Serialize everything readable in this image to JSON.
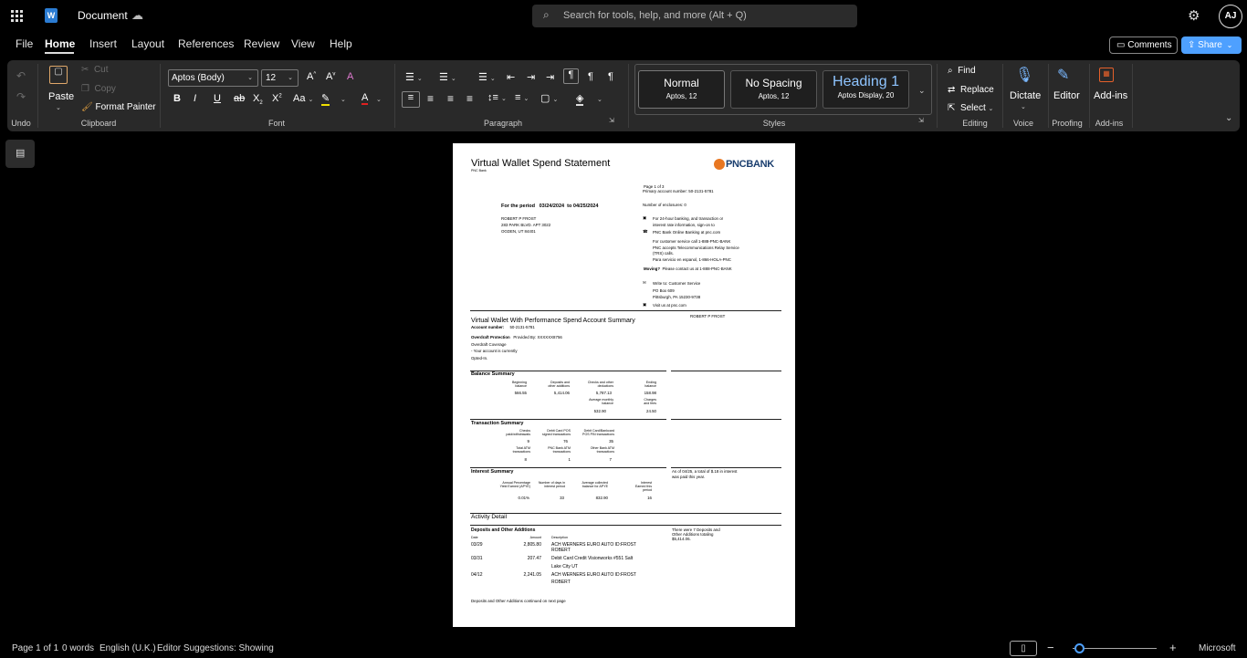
{
  "app": {
    "title": "Document",
    "account_initials": "AJ",
    "search_placeholder": "Search for tools, help, and more (Alt + Q)"
  },
  "menu": {
    "file": "File",
    "home": "Home",
    "insert": "Insert",
    "layout": "Layout",
    "references": "References",
    "review": "Review",
    "view": "View",
    "help": "Help",
    "comments": "Comments",
    "share": "Share"
  },
  "ribbon": {
    "undo_group": "Undo",
    "clipboard": {
      "paste": "Paste",
      "cut": "Cut",
      "copy": "Copy",
      "format_painter": "Format Painter",
      "label": "Clipboard"
    },
    "font": {
      "family": "Aptos (Body)",
      "size": "12",
      "label": "Font"
    },
    "paragraph": {
      "label": "Paragraph"
    },
    "styles": {
      "label": "Styles",
      "items": [
        {
          "name": "Normal",
          "sub": "Aptos, 12"
        },
        {
          "name": "No Spacing",
          "sub": "Aptos, 12"
        },
        {
          "name": "Heading 1",
          "sub": "Aptos Display, 20"
        }
      ]
    },
    "editing": {
      "find": "Find",
      "replace": "Replace",
      "select": "Select",
      "label": "Editing"
    },
    "voice": {
      "dictate": "Dictate",
      "label": "Voice"
    },
    "proofing": {
      "editor": "Editor",
      "label": "Proofing"
    },
    "addins": {
      "addins": "Add-ins",
      "label": "Add-ins"
    }
  },
  "doc": {
    "title": "Virtual Wallet Spend Statement",
    "subtitle": "PNC Bank",
    "logo_text": "PNCBANK",
    "period_label": "For the period",
    "period_from": "03/24/2024",
    "period_to": "to 04/25/2024",
    "address": [
      "ROBERT P FROST",
      "283 PARK BLVD. APT 3022",
      "OGDEN, UT 84401"
    ],
    "page_of": "Page 1 of 3",
    "primary_acct": "Primary account number:   50-2131-5781",
    "enclosures": "Number of enclosures:      0",
    "banking": [
      "For 24-hour banking, and transaction or",
      "interest rate information, sign-on to",
      "PNC Bank Online Banking at pnc.com"
    ],
    "service": [
      "For customer service call 1-888-PNC-BANK",
      "PNC accepts Telecommunications Relay Service",
      "(TRS) calls.",
      "Para servicio en espanol, 1-866-HOLA-PNC"
    ],
    "moving_label": "Moving?",
    "moving": "Please contact us at 1-888-PNC-BANK",
    "write": [
      "Write to:  Customer Service",
      "PO Box 609",
      "Pittsburgh, PA  15230-9738"
    ],
    "visit": "Visit us at pnc.com",
    "summary_title": "Virtual Wallet With Performance Spend Account Summary",
    "owner": "ROBERT P FROST",
    "acct_label": "Account number:",
    "acct_num": "50-2131-5781",
    "overdraft_label": "Overdraft Protection",
    "provided_by": "Provided By:  XXXXXX8756",
    "overdraft_lines": [
      "Overdraft Coverage",
      "- Your account is currently",
      "Opted-In."
    ],
    "balance": {
      "title": "Balance Summary",
      "h1": [
        "Beginning",
        "balance"
      ],
      "h2": [
        "Deposits and",
        "other additions"
      ],
      "h3": [
        "Checks and other",
        "deductions"
      ],
      "h4": [
        "Ending",
        "balance"
      ],
      "v1": "566.55",
      "v2": "5,414.06",
      "v3": "5,787.13",
      "v4": "158.98",
      "h5": [
        "Average monthly",
        "balance"
      ],
      "h6": [
        "Charges",
        "and fees"
      ],
      "v5": "532.90",
      "v6": "24.50"
    },
    "txn": {
      "title": "Transaction Summary",
      "h1": [
        "Checks",
        "paid/withdrawals"
      ],
      "h2": [
        "Debit Card POS",
        "signed transactions"
      ],
      "h3": [
        "Debit Card/Bankcard",
        "POS PIN transactions"
      ],
      "v1": "9",
      "v2": "76",
      "v3": "35",
      "h4": [
        "Total ATM",
        "transactions"
      ],
      "h5": [
        "PNC Bank ATM",
        "transactions"
      ],
      "h6": [
        "Other Bank ATM",
        "transactions"
      ],
      "v4": "8",
      "v5": "1",
      "v6": "7"
    },
    "interest": {
      "title": "Interest Summary",
      "h1": [
        "Annual Percentage",
        "Yield Earned (APYE)"
      ],
      "h2": [
        "Number of days in",
        "interest period"
      ],
      "h3": [
        "Average collected",
        "balance for APYE"
      ],
      "h4": [
        "Interest",
        "Earned this",
        "period"
      ],
      "v1": "0.01%",
      "v2": "33",
      "v3": "832.90",
      "v4": "16",
      "note": [
        "As of 04/25, a total of $.18 in interest",
        "was paid this year."
      ]
    },
    "activity": {
      "title": "Activity Detail",
      "subtitle": "Deposits and Other Additions",
      "col_date": "Date",
      "col_amount": "Amount",
      "col_desc": "Description",
      "rows": [
        {
          "date": "03/29",
          "amount": "2,805.80",
          "d1": "ACH WERNERS EURO AUTO ID:FROST",
          "d2": "ROBERT"
        },
        {
          "date": "03/31",
          "amount": "207.47",
          "d1": "Debit Card Credit Visionworks #551 Salt",
          "d2": "Lake City UT"
        },
        {
          "date": "04/12",
          "amount": "2,241.05",
          "d1": "ACH WERNERS EURO AUTO ID:FROST",
          "d2": "ROBERT"
        }
      ],
      "note": [
        "There were 7 Deposits and",
        "Other Additions totaling",
        "$5,414.06."
      ],
      "continued": "Deposits and Other Additions continued on next page"
    }
  },
  "status": {
    "page": "Page 1 of 1",
    "words": "0 words",
    "language": "English (U.K.)",
    "editor": "Editor Suggestions: Showing",
    "brand": "Microsoft"
  }
}
